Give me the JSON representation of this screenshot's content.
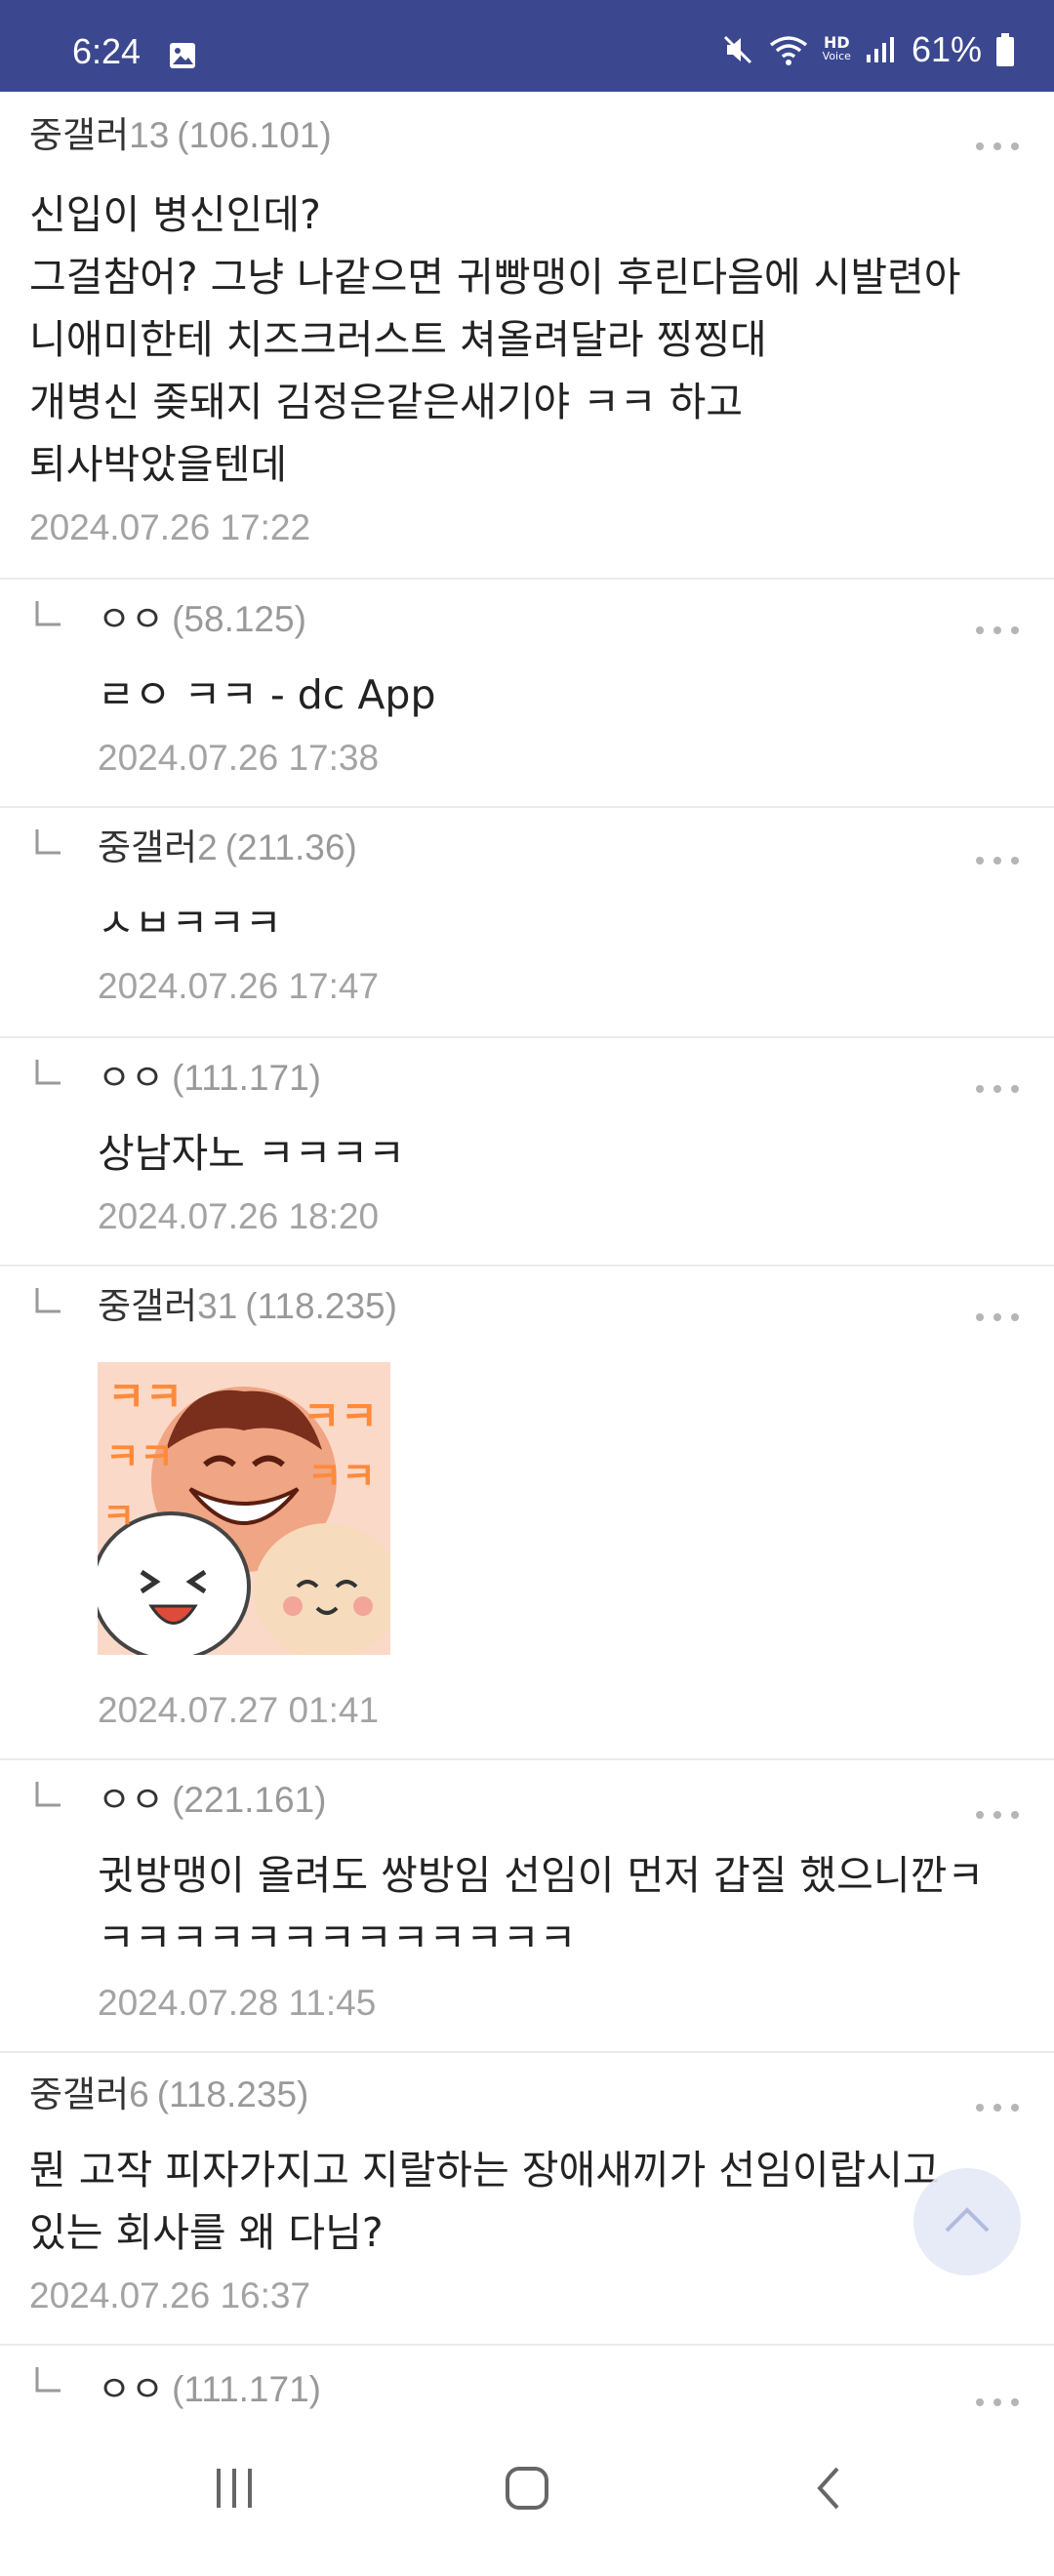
{
  "status_bar": {
    "time": "6:24",
    "battery": "61%",
    "icons": [
      "gallery-icon",
      "mute-icon",
      "wifi-icon",
      "hd-voice-icon",
      "signal-icon",
      "battery-icon"
    ],
    "hd_label_top": "HD",
    "hd_label_bottom": "Voice"
  },
  "comments": [
    {
      "type": "top",
      "nick": "중갤러",
      "nick_num": "13",
      "ip": "(106.101)",
      "body": "신입이 병신인데?\n그걸참어? 그냥 나같으면 귀빵맹이 후린다음에 시발련아\n니애미한테 치즈크러스트 쳐올려달라 찡찡대\n개병신 좆돼지 김정은같은새기야 ㅋㅋ 하고\n퇴사박았을텐데",
      "date": "2024.07.26 17:22"
    },
    {
      "type": "reply",
      "nick": "ㅇㅇ",
      "nick_num": "",
      "ip": "(58.125)",
      "body": "ㄹㅇ ㅋㅋ - dc App",
      "date": "2024.07.26 17:38"
    },
    {
      "type": "reply",
      "nick": "중갤러",
      "nick_num": "2",
      "ip": "(211.36)",
      "body": "ㅅㅂㅋㅋㅋ",
      "date": "2024.07.26 17:47"
    },
    {
      "type": "reply",
      "nick": "ㅇㅇ",
      "nick_num": "",
      "ip": "(111.171)",
      "body": "상남자노 ㅋㅋㅋㅋ",
      "date": "2024.07.26 18:20"
    },
    {
      "type": "reply",
      "nick": "중갤러",
      "nick_num": "31",
      "ip": "(118.235)",
      "body": "",
      "date": "2024.07.27 01:41"
    },
    {
      "type": "reply",
      "nick": "ㅇㅇ",
      "nick_num": "",
      "ip": "(221.161)",
      "body": "귓방맹이 올려도 쌍방임 선임이 먼저 갑질 했으니깐ㅋ\nㅋㅋㅋㅋㅋㅋㅋㅋㅋㅋㅋㅋㅋ",
      "date": "2024.07.28 11:45"
    },
    {
      "type": "top",
      "nick": "중갤러",
      "nick_num": "6",
      "ip": "(118.235)",
      "body": "뭔 고작 피자가지고 지랄하는 장애새끼가 선임이랍시고\n있는 회사를 왜 다님?",
      "date": "2024.07.26 16:37"
    },
    {
      "type": "reply",
      "nick": "ㅇㅇ",
      "nick_num": "",
      "ip": "(111.171)",
      "body": "",
      "date": ""
    }
  ],
  "colors": {
    "status_bar": "#3b4890",
    "meta_gray": "#999999",
    "date_gray": "#a3a3a3",
    "divider": "#ebebeb"
  },
  "nav": {
    "items": [
      "recent-apps-icon",
      "home-icon",
      "back-icon"
    ]
  }
}
